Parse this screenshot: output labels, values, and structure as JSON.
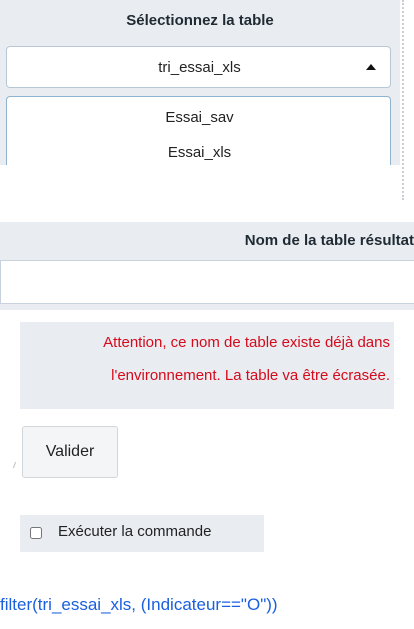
{
  "select_table": {
    "label": "Sélectionnez la table",
    "selected": "tri_essai_xls",
    "options": [
      "Essai_sav",
      "Essai_xls"
    ]
  },
  "result_table": {
    "label": "Nom de la table résultat",
    "value": ""
  },
  "warning": {
    "line1": "Attention, ce nom de table existe déjà dans",
    "line2": "l'environnement. La table va être écrasée."
  },
  "validate_label": "Valider",
  "execute": {
    "label": "Exécuter la commande",
    "checked": false
  },
  "command": "filter(tri_essai_xls, (Indicateur==\"O\"))",
  "colors": {
    "panel_bg": "#e9edf2",
    "warning_text": "#d50a1b",
    "command_text": "#1a5fe0"
  }
}
